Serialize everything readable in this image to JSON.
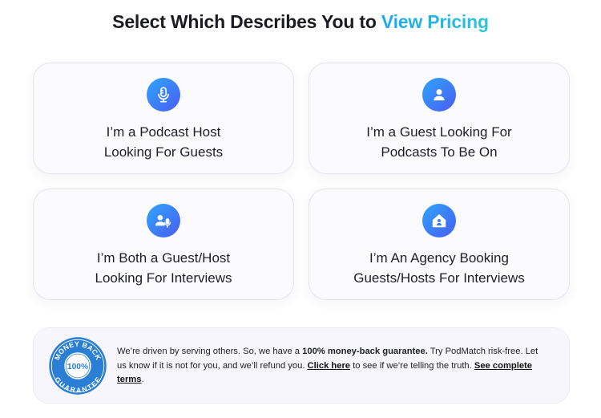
{
  "heading": {
    "prefix": "Select Which Describes You to ",
    "accent": "View Pricing",
    "accent_colors": [
      "#1aa8f0",
      "#2ec4d8"
    ]
  },
  "cards": [
    {
      "icon": "microphone-icon",
      "line1": "I’m a Podcast Host",
      "line2": "Looking For Guests"
    },
    {
      "icon": "person-icon",
      "line1": "I’m a Guest Looking For",
      "line2": "Podcasts To Be On"
    },
    {
      "icon": "person-microphone-icon",
      "line1": "I’m Both a Guest/Host",
      "line2": "Looking For Interviews"
    },
    {
      "icon": "agency-house-icon",
      "line1": "I’m An Agency Booking",
      "line2": "Guests/Hosts For Interviews"
    }
  ],
  "icon_gradient": [
    "#2ea6ff",
    "#4a5cf0"
  ],
  "badge": {
    "icon": "money-back-guarantee-badge-icon",
    "top_text": "MONEY BACK",
    "center_text": "100%",
    "bottom_text": "GUARANTEE",
    "color": "#2a7fd4"
  },
  "guarantee": {
    "text1": "We’re driven by serving others. So, we have a ",
    "bold1": "100% money-back guarantee.",
    "text2": " Try PodMatch risk-free. Let us know if it is not for you, and we’ll refund you. ",
    "link1": "Click here",
    "text3": " to see if we’re telling the truth. ",
    "link2": "See complete terms",
    "text4": "."
  }
}
